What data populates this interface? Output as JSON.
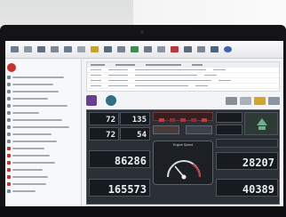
{
  "gauges": {
    "left_top_a": "72",
    "left_top_b": "135",
    "left_mid_a": "72",
    "left_mid_b": "54",
    "left_big_1": "86286",
    "left_big_2": "165573",
    "right_big_1": "28207",
    "right_big_2": "40389"
  },
  "speedometer": {
    "title": "Engine Speed"
  },
  "icons": [
    "toolbar-icon"
  ],
  "colors": {
    "dashboard_bg": "#2b3037",
    "gauge_bg": "#171a1e",
    "accent_red": "#c9332c"
  }
}
